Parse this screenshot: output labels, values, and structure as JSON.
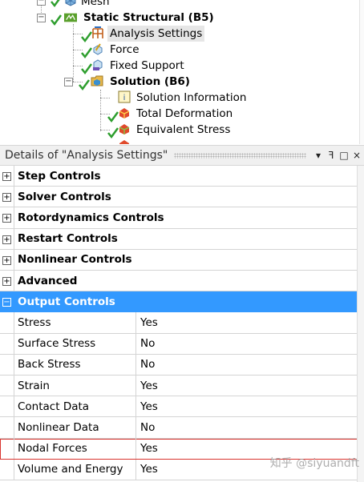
{
  "tree": {
    "nodes": [
      {
        "label": "Mesh",
        "bold": false,
        "icon": "mesh-icon"
      },
      {
        "label": "Static Structural (B5)",
        "bold": true,
        "icon": "static-structural-icon"
      },
      {
        "label": "Analysis Settings",
        "bold": false,
        "icon": "analysis-settings-icon",
        "selected": true
      },
      {
        "label": "Force",
        "bold": false,
        "icon": "force-icon"
      },
      {
        "label": "Fixed Support",
        "bold": false,
        "icon": "fixed-support-icon"
      },
      {
        "label": "Solution (B6)",
        "bold": true,
        "icon": "solution-icon"
      },
      {
        "label": "Solution Information",
        "bold": false,
        "icon": "solution-information-icon"
      },
      {
        "label": "Total Deformation",
        "bold": false,
        "icon": "total-deformation-icon"
      },
      {
        "label": "Equivalent Stress",
        "bold": false,
        "icon": "equivalent-stress-icon"
      }
    ]
  },
  "details": {
    "title": "Details of \"Analysis Settings\"",
    "title_buttons": {
      "dropdown": "▾",
      "pin": "ꟻ",
      "maximize": "□",
      "close": "×"
    },
    "categories": [
      {
        "label": "Step Controls",
        "expanded": false
      },
      {
        "label": "Solver Controls",
        "expanded": false
      },
      {
        "label": "Rotordynamics Controls",
        "expanded": false
      },
      {
        "label": "Restart Controls",
        "expanded": false
      },
      {
        "label": "Nonlinear Controls",
        "expanded": false
      },
      {
        "label": "Advanced",
        "expanded": false
      },
      {
        "label": "Output Controls",
        "expanded": true
      }
    ],
    "output_controls": [
      {
        "name": "Stress",
        "value": "Yes"
      },
      {
        "name": "Surface Stress",
        "value": "No"
      },
      {
        "name": "Back Stress",
        "value": "No"
      },
      {
        "name": "Strain",
        "value": "Yes"
      },
      {
        "name": "Contact Data",
        "value": "Yes"
      },
      {
        "name": "Nonlinear Data",
        "value": "No"
      },
      {
        "name": "Nodal Forces",
        "value": "Yes",
        "highlighted": true
      },
      {
        "name": "Volume and Energy",
        "value": "Yes"
      }
    ],
    "expander_plus": "+",
    "expander_minus": "−"
  },
  "watermark": "知乎 @siyuandft",
  "colors": {
    "selection_blue": "#3399ff",
    "highlight_red": "#d9332e",
    "check_green": "#2e9e2e"
  }
}
